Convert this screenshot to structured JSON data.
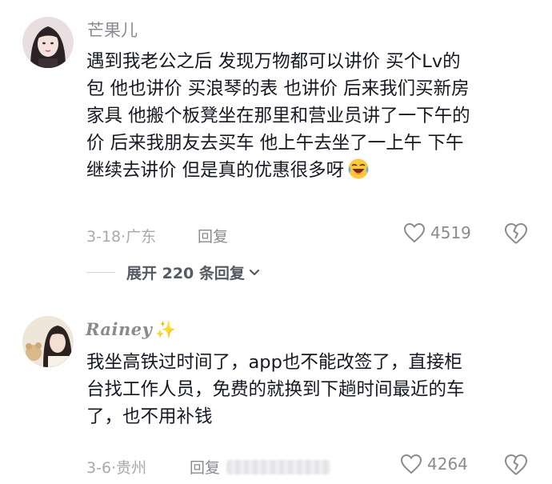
{
  "comments": [
    {
      "username": "芒果儿",
      "text_lines": [
        "遇到我老公之后 发现万物都可以讲价 买个Lv的",
        "包 他也讲价 买浪琴的表 也讲价 后来我们买新房",
        "家具 他搬个板凳坐在那里和营业员讲了一下午的",
        "价 后来我朋友去买车 他上午去坐了一上午 下午",
        "继续去讲价 但是真的优惠很多呀"
      ],
      "emoji": "laughing-tears-icon",
      "date": "3-18",
      "location": "广东",
      "reply_label": "回复",
      "likes": "4519",
      "expand_label": "展开 220 条回复"
    },
    {
      "username": "Rainey",
      "username_decoration": "✨",
      "text_lines": [
        "我坐高铁过时间了，app也不能改签了，直接柜",
        "台找工作人员，免费的就换到下趟时间最近的车",
        "了，也不用补钱"
      ],
      "date": "3-6",
      "location": "贵州",
      "reply_label": "回复",
      "likes": "4264"
    }
  ],
  "separator": "·",
  "colors": {
    "text": "#161823",
    "meta": "#a8a9ad",
    "secondary": "#8a8b91",
    "expand": "#555a62"
  }
}
